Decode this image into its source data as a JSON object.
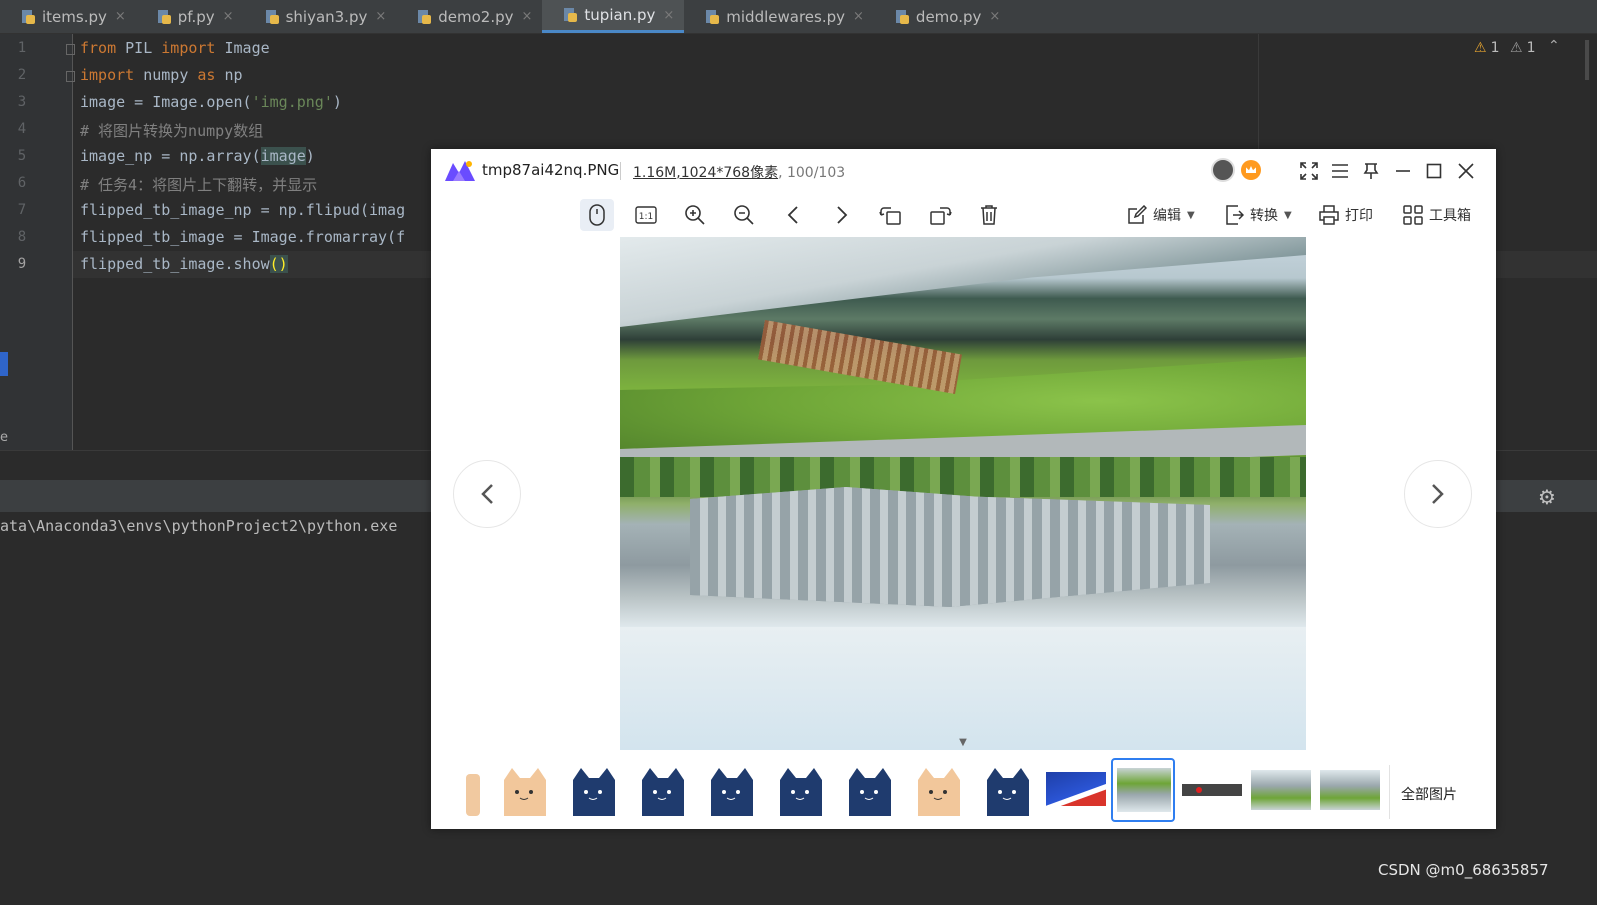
{
  "ide": {
    "tabs": [
      {
        "label": "items.py",
        "close": "×"
      },
      {
        "label": "pf.py",
        "close": "×"
      },
      {
        "label": "shiyan3.py",
        "close": "×"
      },
      {
        "label": "demo2.py",
        "close": "×"
      },
      {
        "label": "tupian.py",
        "close": "×"
      },
      {
        "label": "middlewares.py",
        "close": "×"
      },
      {
        "label": "demo.py",
        "close": "×"
      }
    ],
    "line_numbers": [
      "1",
      "2",
      "3",
      "4",
      "5",
      "6",
      "7",
      "8",
      "9"
    ],
    "code": {
      "l1": {
        "kw1": "from",
        "t1": " PIL ",
        "kw2": "import",
        "t2": " Image"
      },
      "l2": {
        "kw1": "import",
        "t1": " numpy ",
        "kw2": "as",
        "t2": " np"
      },
      "l3": {
        "t1": "image = Image.open(",
        "s1": "'img.png'",
        "t2": ")"
      },
      "l4": {
        "c": "# 将图片转换为numpy数组"
      },
      "l5": {
        "t1": "image_np = np.array(",
        "h": "image",
        "t2": ")"
      },
      "l6": {
        "c": "# 任务4：将图片上下翻转，并显示"
      },
      "l7": {
        "t": "flipped_tb_image_np = np.flipud(imag"
      },
      "l8": {
        "t": "flipped_tb_image = Image.fromarray(f"
      },
      "l9": {
        "t": "flipped_tb_image.show",
        "p": "()"
      }
    },
    "warnings": [
      {
        "icon": "warning-icon",
        "count": "1"
      },
      {
        "icon": "weak-warning-icon",
        "count": "1"
      }
    ],
    "left_text": "e",
    "console_line": "ata\\Anaconda3\\envs\\pythonProject2\\python.exe"
  },
  "viewer": {
    "filename": "tmp87ai42nq.PNG",
    "size": "1.16M",
    "resolution": ",1024*768像素",
    "index": ", 100/103",
    "toolbar": {
      "edit": "编辑",
      "convert": "转换",
      "print": "打印",
      "toolbox": "工具箱"
    },
    "all_images": "全部图片",
    "accent": "#2f7ef0"
  },
  "watermark": "CSDN @m0_68635857"
}
